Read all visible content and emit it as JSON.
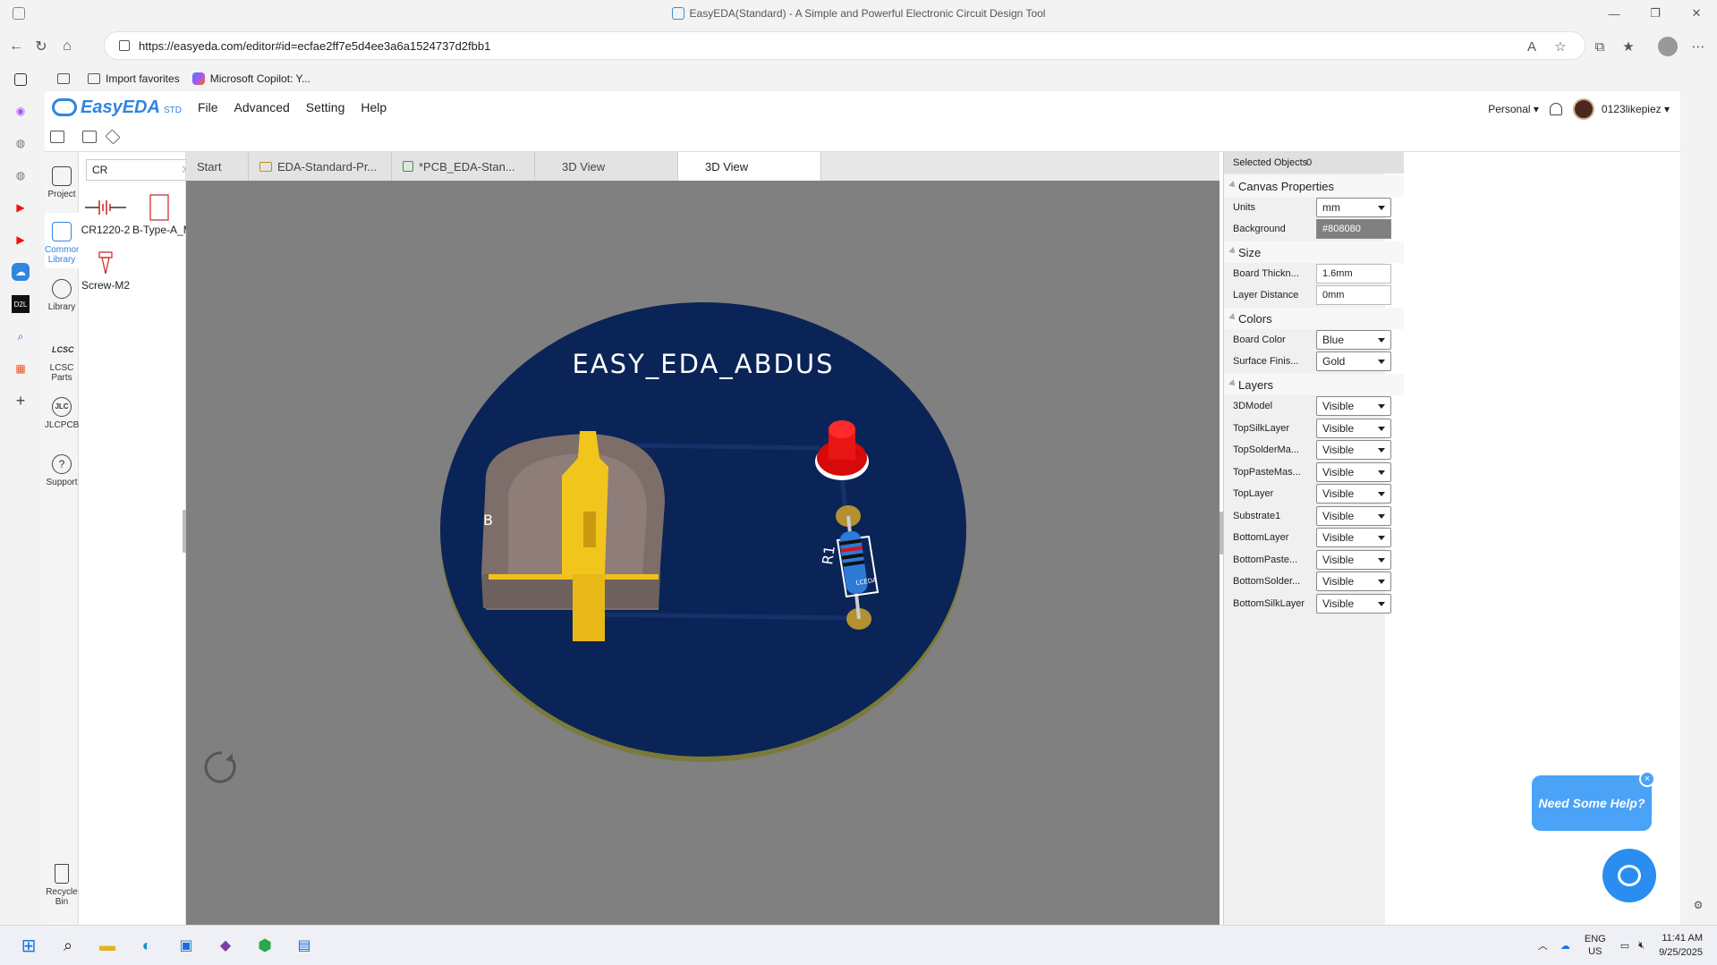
{
  "browser": {
    "title": "EasyEDA(Standard) - A Simple and Powerful Electronic Circuit Design Tool",
    "url": "https://easyeda.com/editor#id=ecfae2ff7e5d4ee3a6a1524737d2fbb1",
    "favorites": [
      "Import favorites",
      "Microsoft Copilot: Y..."
    ]
  },
  "app": {
    "logo": "EasyEDA",
    "logo_suffix": "STD",
    "menu": [
      "File",
      "Advanced",
      "Setting",
      "Help"
    ],
    "account_type": "Personal",
    "username": "0123likepiez"
  },
  "leftnav": {
    "project": "Project",
    "common_library": "Common Library",
    "library": "Library",
    "lcsc_parts": "LCSC Parts",
    "jlcpcb": "JLCPCB",
    "support": "Support",
    "recycle_bin": "Recycle Bin"
  },
  "library": {
    "search_value": "CR",
    "items": [
      "CR1220-2",
      "B-Type-A_M",
      "Screw-M2"
    ]
  },
  "tabs": [
    "Start",
    "EDA-Standard-Pr...",
    "*PCB_EDA-Stan...",
    "3D View",
    "3D View"
  ],
  "canvas": {
    "board_text": "EASY_EDA_ABDUS",
    "ref_r1": "R1",
    "ref_b": "B",
    "resistor_mark": "LCEDA",
    "colors": {
      "background": "#808080",
      "board": "#0b2457",
      "silkscreen": "#ffffff"
    }
  },
  "props": {
    "selected_label": "Selected Objects",
    "selected_count": "0",
    "canvas_properties": "Canvas Properties",
    "units_label": "Units",
    "units_value": "mm",
    "background_label": "Background",
    "background_value": "#808080",
    "size": "Size",
    "board_thickness_label": "Board Thickn...",
    "board_thickness_value": "1.6mm",
    "layer_distance_label": "Layer Distance",
    "layer_distance_value": "0mm",
    "colors": "Colors",
    "board_color_label": "Board Color",
    "board_color_value": "Blue",
    "surface_finish_label": "Surface Finis...",
    "surface_finish_value": "Gold",
    "layers": "Layers",
    "layer_rows": [
      {
        "label": "3DModel",
        "value": "Visible"
      },
      {
        "label": "TopSilkLayer",
        "value": "Visible"
      },
      {
        "label": "TopSolderMa...",
        "value": "Visible"
      },
      {
        "label": "TopPasteMas...",
        "value": "Visible"
      },
      {
        "label": "TopLayer",
        "value": "Visible"
      },
      {
        "label": "Substrate1",
        "value": "Visible"
      },
      {
        "label": "BottomLayer",
        "value": "Visible"
      },
      {
        "label": "BottomPaste...",
        "value": "Visible"
      },
      {
        "label": "BottomSolder...",
        "value": "Visible"
      },
      {
        "label": "BottomSilkLayer",
        "value": "Visible"
      }
    ]
  },
  "help": {
    "bubble": "Need Some Help?",
    "close": "×"
  },
  "taskbar": {
    "lang_top": "ENG",
    "lang_bottom": "US",
    "time": "11:41 AM",
    "date": "9/25/2025"
  }
}
